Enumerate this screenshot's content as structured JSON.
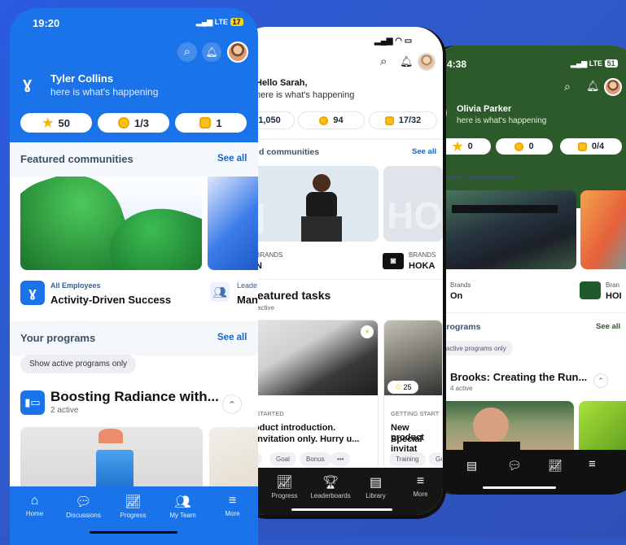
{
  "phone_front": {
    "status_time": "19:20",
    "status_network": "LTE",
    "status_battery": "17",
    "user_name": "Tyler Collins",
    "greeting": "here is what's happening",
    "stats": [
      {
        "icon": "star-icon",
        "value": "50"
      },
      {
        "icon": "check-coin-icon",
        "value": "1/3"
      },
      {
        "icon": "badge-icon",
        "value": "1"
      }
    ],
    "featured_title": "Featured communities",
    "see_all": "See all",
    "community_1": {
      "category": "All Employees",
      "name": "Activity-Driven Success"
    },
    "community_2": {
      "category": "Leade",
      "name": "Man"
    },
    "programs_title": "Your programs",
    "programs_see_all": "See all",
    "filter_chip": "Show active programs only",
    "program": {
      "title": "Boosting Radiance with...",
      "meta": "2 active"
    },
    "nav": [
      "Home",
      "Discussions",
      "Progress",
      "My Team",
      "More"
    ]
  },
  "phone_middle": {
    "greeting_name": "Hello Sarah,",
    "greeting": "here is what's happening",
    "stats": [
      {
        "icon": "star-icon",
        "value": "1,050"
      },
      {
        "icon": "check-coin-icon",
        "value": "94"
      },
      {
        "icon": "badge-icon",
        "value": "17/32"
      }
    ],
    "featured_title": "d communities",
    "see_all": "See all",
    "brands": [
      {
        "category": "BRANDS",
        "name": "N",
        "bg_text": "N"
      },
      {
        "category": "BRANDS",
        "name": "HOKA",
        "bg_text": "HOK"
      }
    ],
    "tasks_title": "eatured tasks",
    "tasks_meta": "active",
    "task_1": {
      "phase": "NG STARTED",
      "title": "product introduction.",
      "subtitle": "al invitation only. Hurry u...",
      "tags": [
        "ng",
        "Goal",
        "Bonus",
        "•••"
      ]
    },
    "task_2": {
      "phase": "GETTING START",
      "title": "New product",
      "subtitle": "Special invitat",
      "rating": "25",
      "tags": [
        "Training",
        "Goa"
      ]
    },
    "nav": [
      "Progress",
      "Leaderboards",
      "Library",
      "More"
    ]
  },
  "phone_back": {
    "status_time": "4:38",
    "status_network": "LTE",
    "status_battery": "51",
    "user_name": "Olivia Parker",
    "greeting": "here is what's happening",
    "stats": [
      {
        "icon": "star-icon",
        "value": "0"
      },
      {
        "icon": "check-coin-icon",
        "value": "0"
      },
      {
        "icon": "badge-icon",
        "value": "0/4"
      }
    ],
    "featured_title": "atured communities",
    "see_all": "See all",
    "brands": [
      {
        "category": "Brands",
        "name": "On"
      },
      {
        "category": "Bran",
        "name": "HOI"
      }
    ],
    "programs_title": "r programs",
    "programs_see_all": "See all",
    "filter_chip": "how active programs only",
    "program": {
      "title": "Brooks: Creating the Run...",
      "meta": "4 active"
    }
  }
}
